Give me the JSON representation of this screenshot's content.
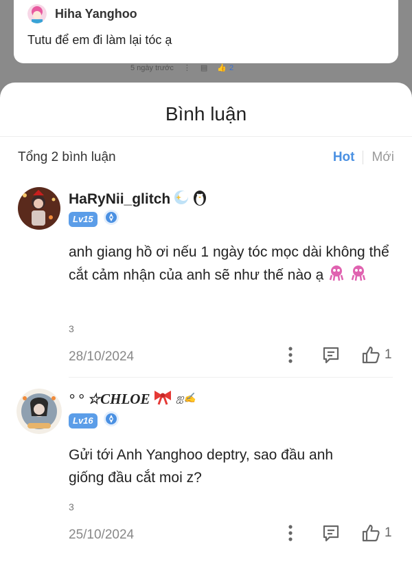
{
  "background_post": {
    "author_name": "Hiha Yanghoo",
    "text": "Tutu để em đi làm lại tóc ạ",
    "time": "5 ngày trước",
    "likes": "2"
  },
  "sheet": {
    "title": "Bình luận",
    "total": "Tổng 2 bình luận",
    "sort_hot": "Hot",
    "sort_new": "Mới"
  },
  "comments": [
    {
      "username": "HaRyNii_glitch",
      "level": "Lv15",
      "text": "anh giang hồ ơi nếu 1 ngày tóc mọc dài không thể cắt cảm nhận của anh sẽ như thế nào ạ",
      "count": "3",
      "date": "28/10/2024",
      "likes": "1"
    },
    {
      "username": "° ° ☆CHLOE",
      "name_suffix": "ஐ✍",
      "level": "Lv16",
      "text": "Gửi tới Anh Yanghoo deptry, sao đầu anh giống đầu cắt moi z?",
      "count": "3",
      "date": "25/10/2024",
      "likes": "1"
    }
  ],
  "colors": {
    "accent": "#4a90e2",
    "level_badge": "#5b9de8"
  }
}
